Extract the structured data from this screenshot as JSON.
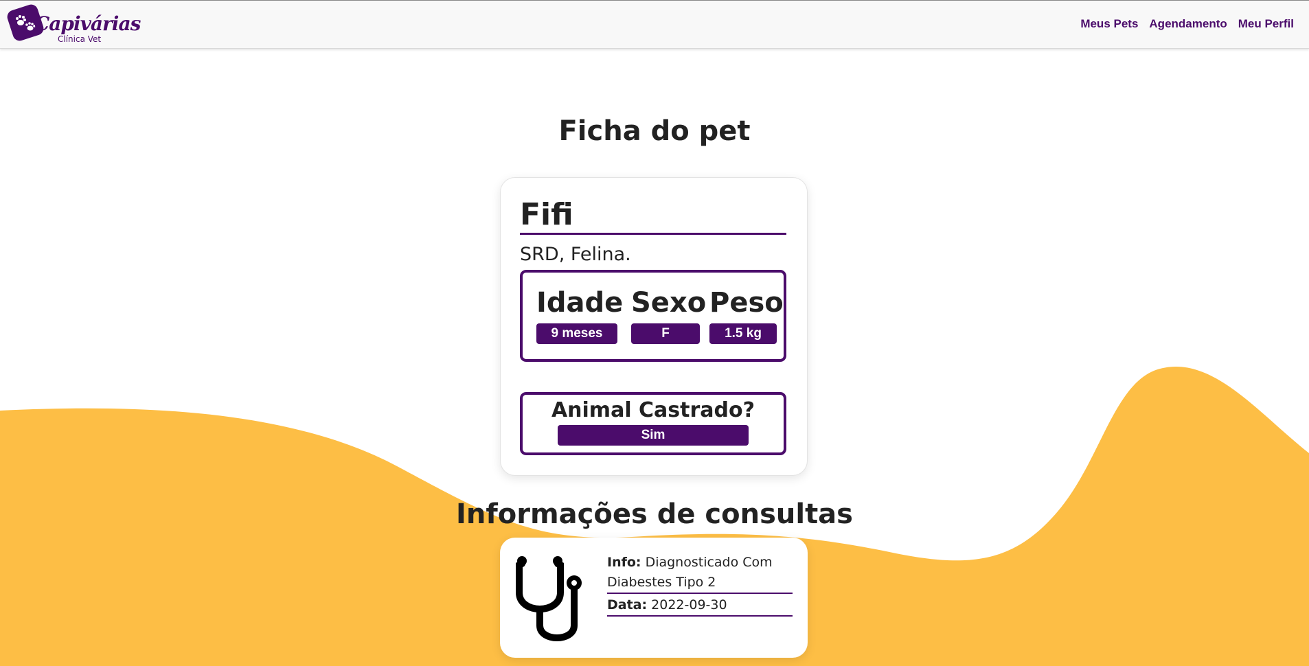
{
  "brand": {
    "name": "Capivárias",
    "subtitle": "Clínica Vet"
  },
  "nav": {
    "links": [
      "Meus Pets",
      "Agendamento",
      "Meu Perfil"
    ]
  },
  "page": {
    "title": "Ficha do pet",
    "consultas_title": "Informações de consultas"
  },
  "pet": {
    "name": "Fifi",
    "breed": "SRD, Felina.",
    "idade_label": "Idade",
    "idade_value": "9 meses",
    "sexo_label": "Sexo",
    "sexo_value": "F",
    "peso_label": "Peso",
    "peso_value": "1.5 kg",
    "castrado_label": "Animal Castrado?",
    "castrado_value": "Sim"
  },
  "consulta": {
    "info_label": "Info:",
    "info_value": "Diagnosticado Com Diabestes Tipo 2",
    "data_label": "Data:",
    "data_value": "2022-09-30",
    "icon": "stethoscope-icon"
  },
  "colors": {
    "primary": "#4b0c6b",
    "wave": "#fdbe45",
    "text": "#222222",
    "navbar_bg": "#f8f8f8"
  }
}
